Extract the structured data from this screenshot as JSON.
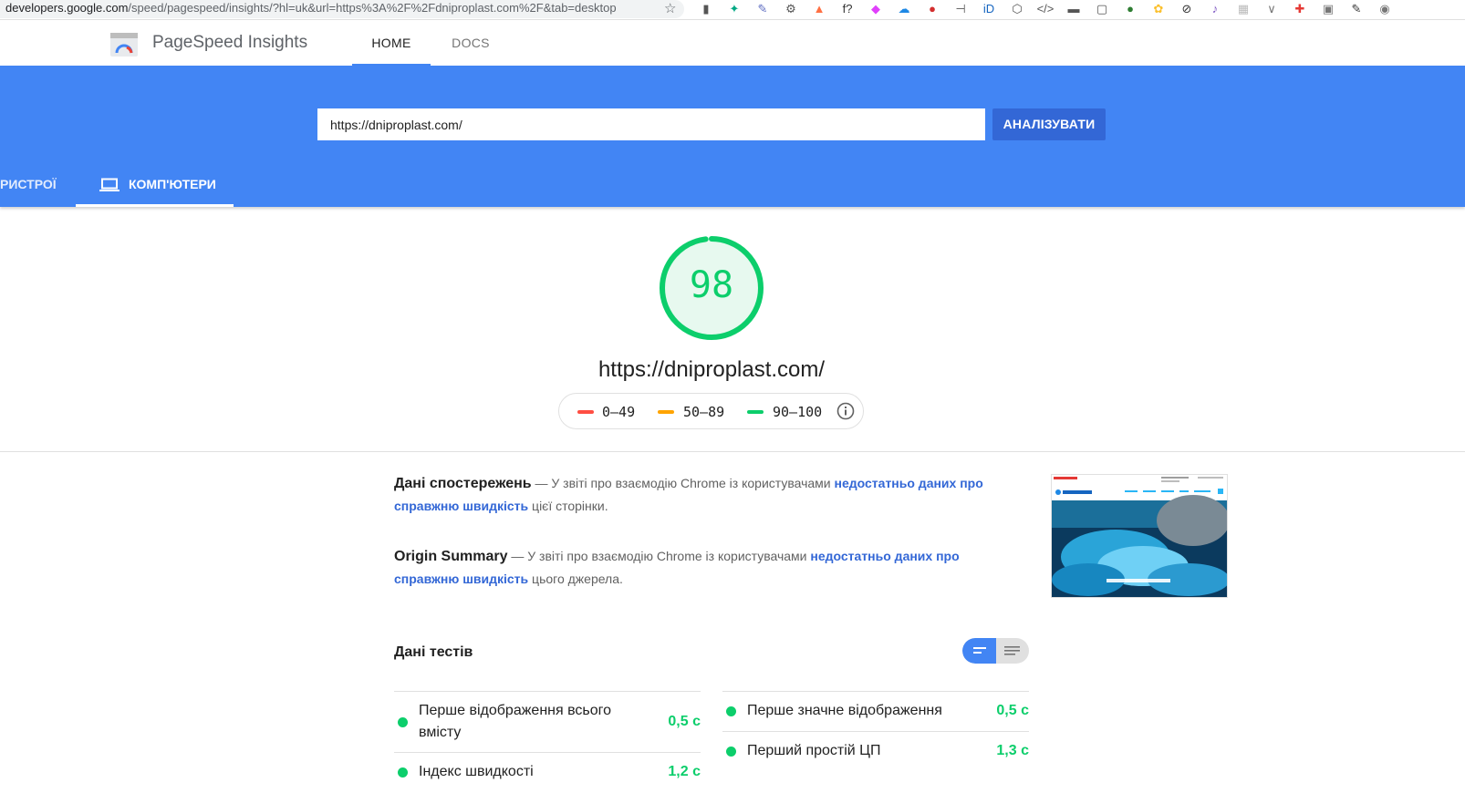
{
  "browser": {
    "url_domain": "developers.google.com",
    "url_path": "/speed/pagespeed/insights/?hl=uk&url=https%3A%2F%2Fdniproplast.com%2F&tab=desktop",
    "extension_icons": [
      "extension-icon",
      "extension-icon",
      "extension-icon",
      "extension-icon",
      "extension-icon",
      "extension-icon",
      "extension-icon",
      "extension-icon",
      "extension-icon",
      "extension-icon",
      "extension-icon",
      "extension-icon",
      "extension-icon",
      "extension-icon",
      "extension-icon",
      "extension-icon",
      "extension-icon",
      "extension-icon",
      "extension-icon",
      "extension-icon",
      "extension-icon",
      "extension-icon",
      "extension-icon",
      "extension-icon",
      "extension-icon"
    ]
  },
  "header": {
    "title": "PageSpeed Insights",
    "tabs": [
      {
        "label": "HOME",
        "active": true
      },
      {
        "label": "DOCS",
        "active": false
      }
    ]
  },
  "search": {
    "value": "https://dniproplast.com/",
    "button_label": "АНАЛІЗУВАТИ"
  },
  "device_tabs": {
    "mobile_label": "РИСТРОЇ",
    "desktop_label": "КОМП'ЮТЕРИ"
  },
  "score": {
    "value": "98",
    "fraction": 0.98,
    "url": "https://dniproplast.com/",
    "color": "#0cce6b"
  },
  "legend": [
    {
      "range": "0–49",
      "color": "#ff4e42"
    },
    {
      "range": "50–89",
      "color": "#ffa400"
    },
    {
      "range": "90–100",
      "color": "#0cce6b"
    }
  ],
  "field_data": {
    "title": "Дані спостережень",
    "text_before": " — У звіті про взаємодію Chrome із користувачами ",
    "link": "недостатньо даних про справжню швидкість",
    "text_after": " цієї сторінки."
  },
  "origin_summary": {
    "title": "Origin Summary",
    "text_before": " — У звіті про взаємодію Chrome із користувачами ",
    "link": "недостатньо даних про справжню швидкість",
    "text_after": " цього джерела."
  },
  "lab": {
    "title": "Дані тестів",
    "metrics": [
      {
        "label": "Перше відображення всього вмісту",
        "value": "0,5 с"
      },
      {
        "label": "Перше значне відображення",
        "value": "0,5 с"
      },
      {
        "label": "Індекс швидкості",
        "value": "1,2 с"
      },
      {
        "label": "Перший простій ЦП",
        "value": "1,3 с"
      }
    ]
  }
}
